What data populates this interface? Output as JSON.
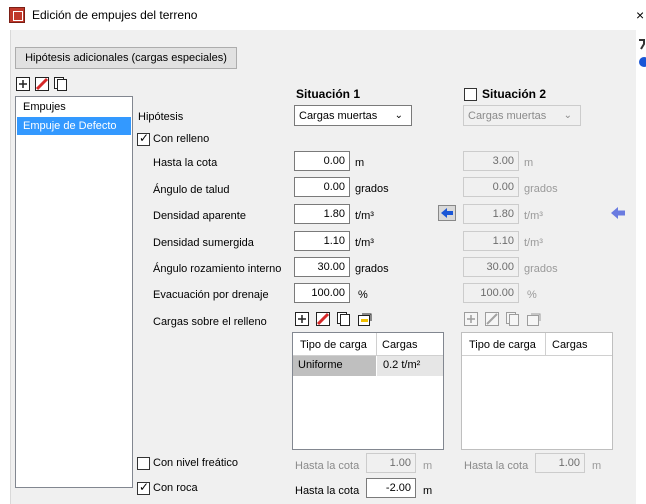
{
  "window": {
    "title": "Edición de empujes del terreno",
    "close": "×"
  },
  "toolbar": {
    "extra_hypotheses_button": "Hipótesis adicionales (cargas especiales)"
  },
  "sidebar": {
    "items": [
      {
        "label": "Empujes"
      },
      {
        "label": "Empuje de Defecto"
      }
    ]
  },
  "labels": {
    "hipotesis": "Hipótesis",
    "con_relleno": "Con relleno",
    "hasta_la_cota": "Hasta la cota",
    "angulo_talud": "Ángulo de talud",
    "densidad_aparente": "Densidad aparente",
    "densidad_sumergida": "Densidad sumergida",
    "angulo_rozamiento": "Ángulo rozamiento interno",
    "evacuacion_drenaje": "Evacuación por drenaje",
    "cargas_relleno": "Cargas sobre el relleno",
    "con_nivel_freatico": "Con nivel freático",
    "con_roca": "Con roca"
  },
  "situation1": {
    "title": "Situación 1",
    "hypothesis": "Cargas muertas",
    "fields": {
      "cota": {
        "value": "0.00",
        "unit": "m"
      },
      "talud": {
        "value": "0.00",
        "unit": "grados"
      },
      "dens_ap": {
        "value": "1.80",
        "unit": "t/m³"
      },
      "dens_sum": {
        "value": "1.10",
        "unit": "t/m³"
      },
      "rozamiento": {
        "value": "30.00",
        "unit": "grados"
      },
      "drenaje": {
        "value": "100.00",
        "unit": "%"
      }
    },
    "loads_table": {
      "headers": [
        "Tipo de carga",
        "Cargas"
      ],
      "rows": [
        {
          "tipo": "Uniforme",
          "carga": "0.2 t/m²"
        }
      ]
    },
    "freatico": {
      "label": "Hasta la cota",
      "value": "1.00",
      "unit": "m"
    },
    "roca": {
      "label": "Hasta la cota",
      "value": "-2.00",
      "unit": "m"
    }
  },
  "situation2": {
    "title": "Situación 2",
    "hypothesis": "Cargas muertas",
    "fields": {
      "cota": {
        "value": "3.00",
        "unit": "m"
      },
      "talud": {
        "value": "0.00",
        "unit": "grados"
      },
      "dens_ap": {
        "value": "1.80",
        "unit": "t/m³"
      },
      "dens_sum": {
        "value": "1.10",
        "unit": "t/m³"
      },
      "rozamiento": {
        "value": "30.00",
        "unit": "grados"
      },
      "drenaje": {
        "value": "100.00",
        "unit": "%"
      }
    },
    "loads_table": {
      "headers": [
        "Tipo de carga",
        "Cargas"
      ]
    },
    "freatico": {
      "label": "Hasta la cota",
      "value": "1.00",
      "unit": "m"
    }
  },
  "colors": {
    "selection": "#3399ff",
    "arrow": "#1a56d6",
    "delete": "#d62828"
  }
}
